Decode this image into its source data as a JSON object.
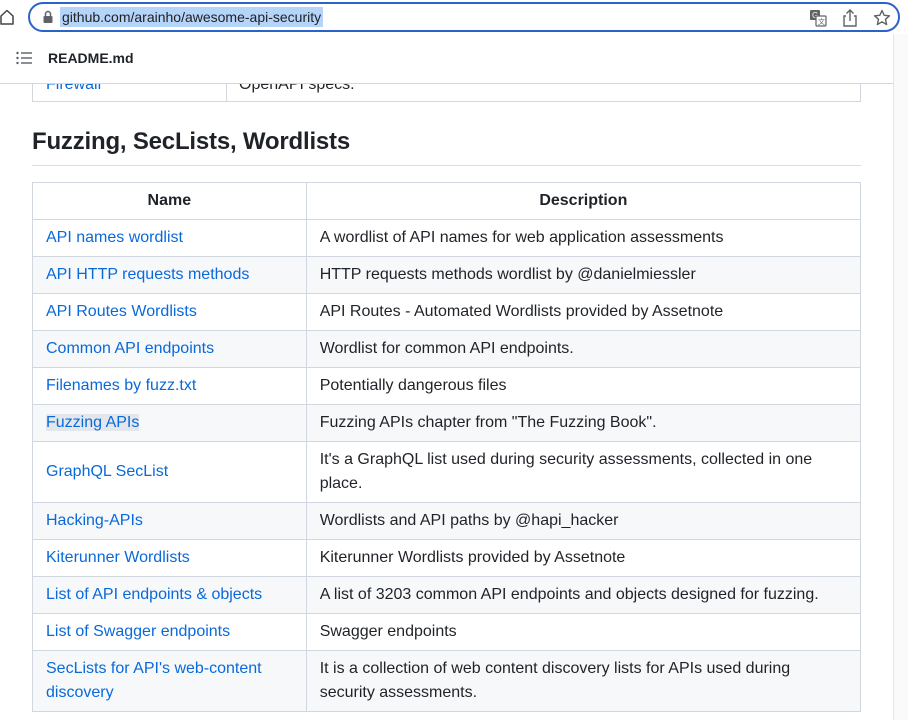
{
  "browser": {
    "url": "github.com/arainho/awesome-api-security"
  },
  "readme_header": {
    "title": "README.md"
  },
  "prev_table": {
    "name": "Firewall",
    "description": "OpenAPI specs."
  },
  "section": {
    "title": "Fuzzing, SecLists, Wordlists"
  },
  "table": {
    "headers": {
      "name": "Name",
      "description": "Description"
    },
    "rows": [
      {
        "name": "API names wordlist",
        "description": "A wordlist of API names for web application assessments"
      },
      {
        "name": "API HTTP requests methods",
        "description": "HTTP requests methods wordlist by @danielmiessler"
      },
      {
        "name": "API Routes Wordlists",
        "description": "API Routes - Automated Wordlists provided by Assetnote"
      },
      {
        "name": "Common API endpoints",
        "description": "Wordlist for common API endpoints."
      },
      {
        "name": "Filenames by fuzz.txt",
        "description": "Potentially dangerous files"
      },
      {
        "name": "Fuzzing APIs",
        "description": "Fuzzing APIs chapter from \"The Fuzzing Book\"."
      },
      {
        "name": "GraphQL SecList",
        "description": "It's a GraphQL list used during security assessments, collected in one place."
      },
      {
        "name": "Hacking-APIs",
        "description": "Wordlists and API paths by @hapi_hacker"
      },
      {
        "name": "Kiterunner Wordlists",
        "description": "Kiterunner Wordlists provided by Assetnote"
      },
      {
        "name": "List of API endpoints & objects",
        "description": "A list of 3203 common API endpoints and objects designed for fuzzing."
      },
      {
        "name": "List of Swagger endpoints",
        "description": "Swagger endpoints"
      },
      {
        "name": "SecLists for API's web-content discovery",
        "description": "It is a collection of web content discovery lists for APIs used during security assessments."
      }
    ]
  },
  "icons": {
    "home": "home-icon",
    "lock": "lock-icon",
    "translate": "translate-icon",
    "share": "share-icon",
    "bookmark": "star-icon",
    "toc": "list-icon"
  },
  "colors": {
    "link": "#0969da",
    "border": "#d0d7de",
    "url_focus": "#2a63c9",
    "url_selection": "#b5d4fa"
  }
}
